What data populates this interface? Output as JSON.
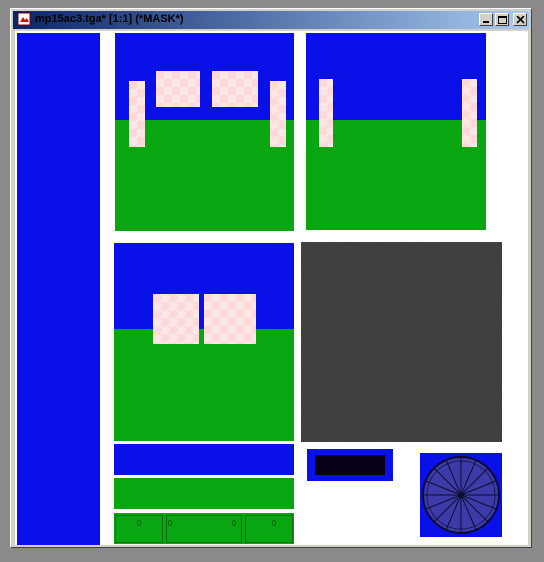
{
  "window": {
    "title": "mp15ac3.tga* [1:1] (*MASK*)",
    "buttons": [
      {
        "name": "minimize-icon"
      },
      {
        "name": "maximize-icon"
      },
      {
        "name": "close-icon"
      }
    ]
  },
  "colors": {
    "titlebar_start": "#0a246a",
    "titlebar_end": "#a6caf0",
    "texture_blue": "#0a10e8",
    "texture_green": "#08a610",
    "texture_pink": "#ffd8d8",
    "texture_gray": "#3f3c3d"
  }
}
